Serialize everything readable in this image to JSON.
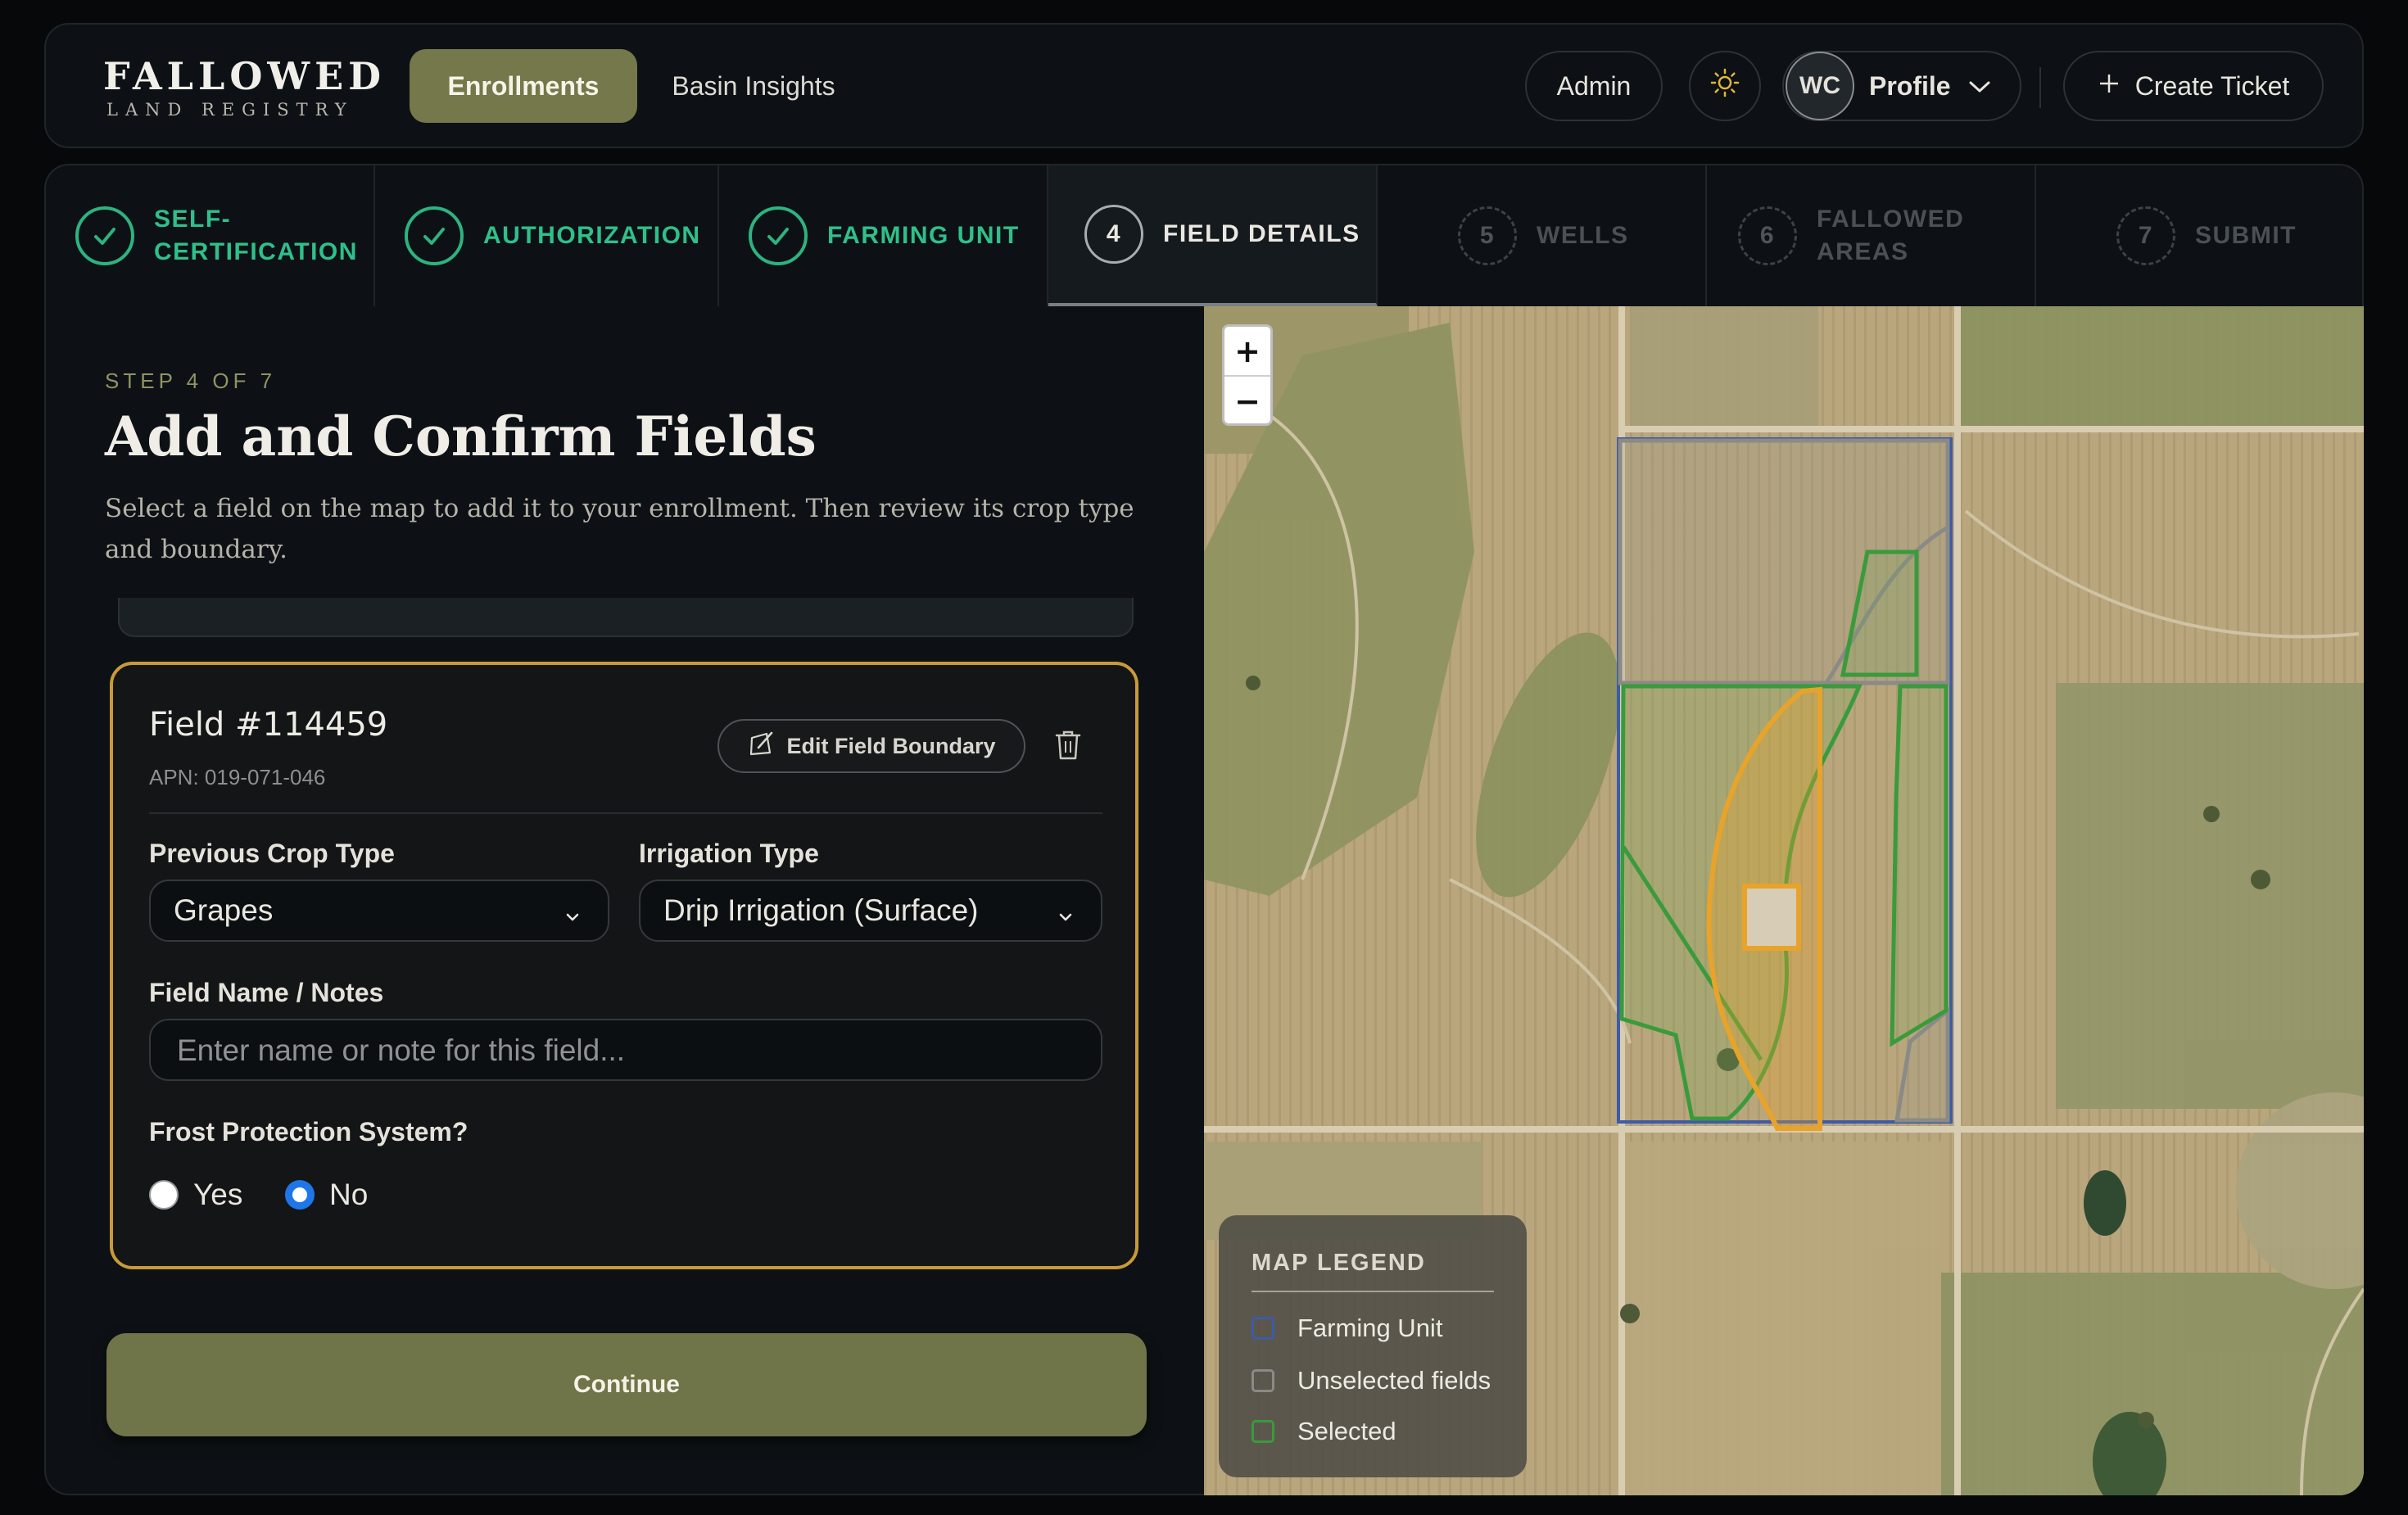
{
  "header": {
    "logo_main": "FALLOWED",
    "logo_sub": "LAND REGISTRY",
    "nav": [
      "Enrollments",
      "Basin Insights"
    ],
    "admin": "Admin",
    "theme_icon": "sun-icon",
    "avatar_initials": "WC",
    "profile": "Profile",
    "create_ticket": "Create Ticket"
  },
  "stepper": [
    {
      "num": "1",
      "label": "SELF-\nCERTIFICATION",
      "state": "done"
    },
    {
      "num": "2",
      "label": "AUTHORIZATION",
      "state": "done"
    },
    {
      "num": "3",
      "label": "FARMING UNIT",
      "state": "done"
    },
    {
      "num": "4",
      "label": "FIELD DETAILS",
      "state": "active"
    },
    {
      "num": "5",
      "label": "WELLS",
      "state": "todo"
    },
    {
      "num": "6",
      "label": "FALLOWED\nAREAS",
      "state": "todo"
    },
    {
      "num": "7",
      "label": "SUBMIT",
      "state": "todo"
    }
  ],
  "page": {
    "kicker": "STEP 4 OF 7",
    "title": "Add and Confirm Fields",
    "subtitle": "Select a field on the map to add it to your enrollment. Then review its crop type and boundary."
  },
  "field": {
    "title": "Field #114459",
    "apn": "APN: 019-071-046",
    "edit_boundary": "Edit Field Boundary",
    "crop_label": "Previous Crop Type",
    "crop_value": "Grapes",
    "irrigation_label": "Irrigation Type",
    "irrigation_value": "Drip Irrigation (Surface)",
    "notes_label": "Field Name / Notes",
    "notes_placeholder": "Enter name or note for this field...",
    "notes_value": "",
    "frost_label": "Frost Protection System?",
    "frost_options": [
      "Yes",
      "No"
    ],
    "frost_selected": "No"
  },
  "continue": "Continue",
  "map": {
    "zoom_in": "+",
    "zoom_out": "−",
    "legend_title": "MAP LEGEND",
    "legend": [
      {
        "label": "Farming Unit",
        "color": "#3d5ba8"
      },
      {
        "label": "Unselected fields",
        "color": "#8a8a86"
      },
      {
        "label": "Selected",
        "color": "#3a9a3c"
      }
    ],
    "selected_field_color": "#e8a32a"
  },
  "colors": {
    "accent_olive": "#74784a",
    "success_green": "#2fc08a",
    "card_border": "#c99a38",
    "radio_blue": "#1e76e8"
  }
}
